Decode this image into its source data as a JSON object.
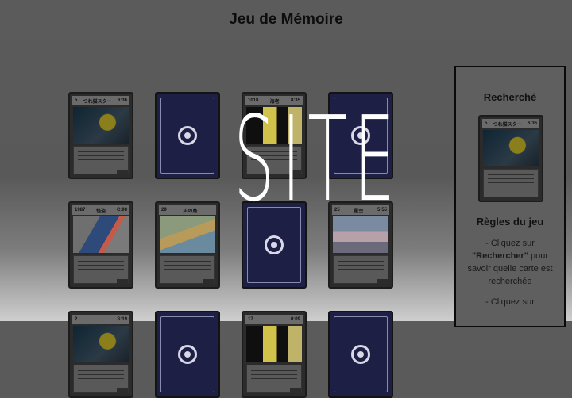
{
  "title": "Jeu de Mémoire",
  "watermark": "SITE",
  "board": {
    "cards": [
      {
        "state": "face-up",
        "top_left": "5",
        "top_mid": "つれ猫スター",
        "top_right": "6:36",
        "art": "a1"
      },
      {
        "state": "face-down"
      },
      {
        "state": "face-up",
        "top_left": "1018",
        "top_mid": "海老",
        "top_right": "8:35",
        "art": "a2"
      },
      {
        "state": "face-down"
      },
      {
        "state": "face-up",
        "top_left": "1987",
        "top_mid": "怪盗",
        "top_right": "C:98",
        "art": "a3"
      },
      {
        "state": "face-up",
        "top_left": "29",
        "top_mid": "火の鳥",
        "top_right": "",
        "art": "a4"
      },
      {
        "state": "face-down"
      },
      {
        "state": "face-up",
        "top_left": "25",
        "top_mid": "星空",
        "top_right": "5:55",
        "art": "a5"
      },
      {
        "state": "face-up",
        "top_left": "2",
        "top_mid": "",
        "top_right": "S:19",
        "art": "a1"
      },
      {
        "state": "face-down"
      },
      {
        "state": "face-up",
        "top_left": "17",
        "top_mid": "",
        "top_right": "0:09",
        "art": "a2"
      },
      {
        "state": "face-down"
      }
    ]
  },
  "sidebar": {
    "searched_title": "Recherché",
    "searched_card": {
      "top_left": "5",
      "top_mid": "つれ猫スター",
      "top_right": "6:36"
    },
    "rules_title": "Règles du jeu",
    "rules": [
      {
        "prefix": "- Cliquez sur ",
        "bold": "\"Rechercher\"",
        "suffix": " pour savoir quelle carte est recherchée"
      },
      {
        "prefix": "- Cliquez sur",
        "bold": "",
        "suffix": ""
      }
    ]
  }
}
